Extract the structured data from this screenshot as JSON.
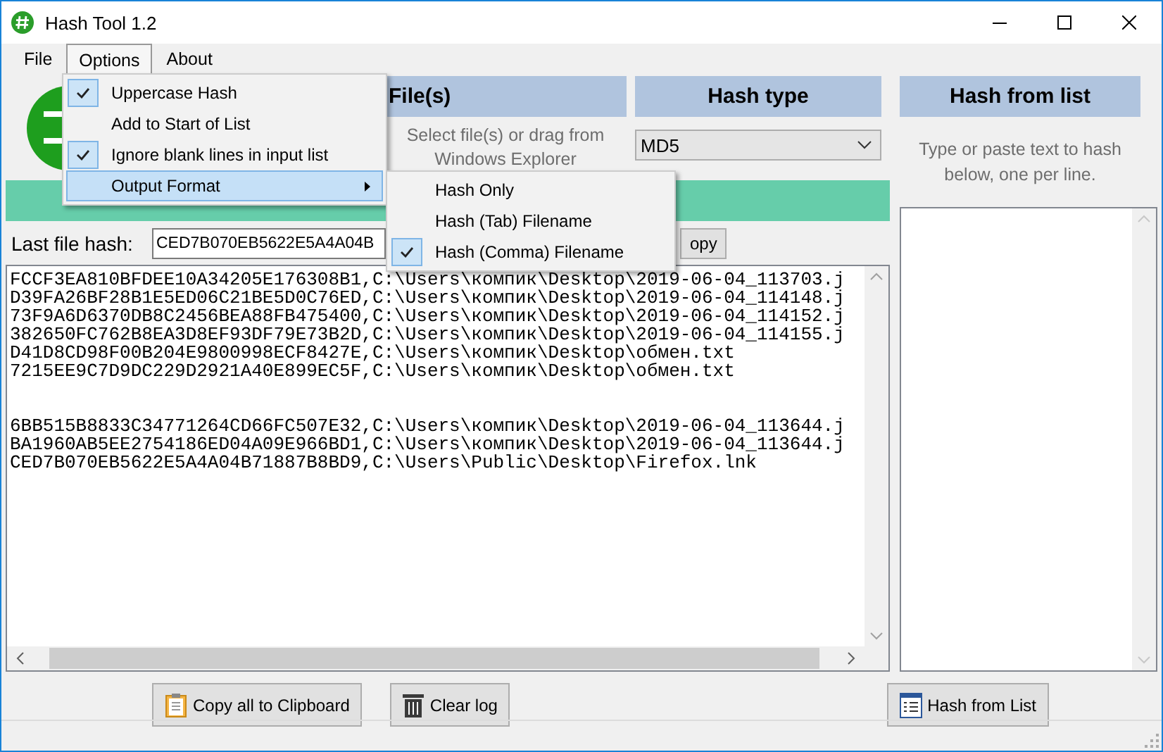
{
  "window": {
    "title": "Hash Tool 1.2"
  },
  "menu_bar": [
    {
      "label": "File",
      "selected": false
    },
    {
      "label": "Options",
      "selected": true
    },
    {
      "label": "About",
      "selected": false
    }
  ],
  "options_menu": [
    {
      "kind": "check",
      "label": "Uppercase Hash",
      "checked": true,
      "selected": false
    },
    {
      "kind": "check",
      "label": "Add to Start of List",
      "checked": false,
      "selected": false
    },
    {
      "kind": "check",
      "label": "Ignore blank lines in input list",
      "checked": true,
      "selected": false
    },
    {
      "kind": "submenu",
      "label": "Output Format",
      "selected": true
    }
  ],
  "output_format_menu": [
    {
      "label": "Hash Only",
      "checked": false
    },
    {
      "label": "Hash (Tab) Filename",
      "checked": false
    },
    {
      "label": "Hash (Comma) Filename",
      "checked": true
    }
  ],
  "file_panel": {
    "header": "File(s)",
    "hint": [
      "Select file(s) or drag from",
      "Windows Explorer"
    ]
  },
  "hash_type": {
    "header": "Hash type",
    "value": "MD5"
  },
  "progress": {
    "level": 1
  },
  "last_hash": {
    "label": "Last file hash:",
    "value": "CED7B070EB5622E5A4A04B",
    "copy_button": "opy"
  },
  "log": {
    "groups": [
      [
        "FCCF3EA810BFDEE10A34205E176308B1,C:\\Users\\компик\\Desktop\\2019-06-04_113703.j",
        "D39FA26BF28B1E5ED06C21BE5D0C76ED,C:\\Users\\компик\\Desktop\\2019-06-04_114148.j",
        "73F9A6D6370DB8C2456BEA88FB475400,C:\\Users\\компик\\Desktop\\2019-06-04_114152.j",
        "382650FC762B8EA3D8EF93DF79E73B2D,C:\\Users\\компик\\Desktop\\2019-06-04_114155.j",
        "D41D8CD98F00B204E9800998ECF8427E,C:\\Users\\компик\\Desktop\\обмен.txt",
        "7215EE9C7D9DC229D2921A40E899EC5F,C:\\Users\\компик\\Desktop\\обмен.txt"
      ],
      [
        "6BB515B8833C34771264CD66FC507E32,C:\\Users\\компик\\Desktop\\2019-06-04_113644.j",
        "BA1960AB5EE2754186ED04A09E966BD1,C:\\Users\\компик\\Desktop\\2019-06-04_113644.j",
        "CED7B070EB5622E5A4A04B71887B8BD9,C:\\Users\\Public\\Desktop\\Firefox.lnk"
      ]
    ]
  },
  "hash_list": {
    "header": "Hash from list",
    "hint": [
      "Type or paste text to hash",
      "below, one per line."
    ]
  },
  "buttons": [
    {
      "kind": "copy",
      "label": "Copy all to Clipboard"
    },
    {
      "kind": "clear",
      "label": "Clear log"
    },
    {
      "kind": "list",
      "label": "Hash from List"
    }
  ]
}
